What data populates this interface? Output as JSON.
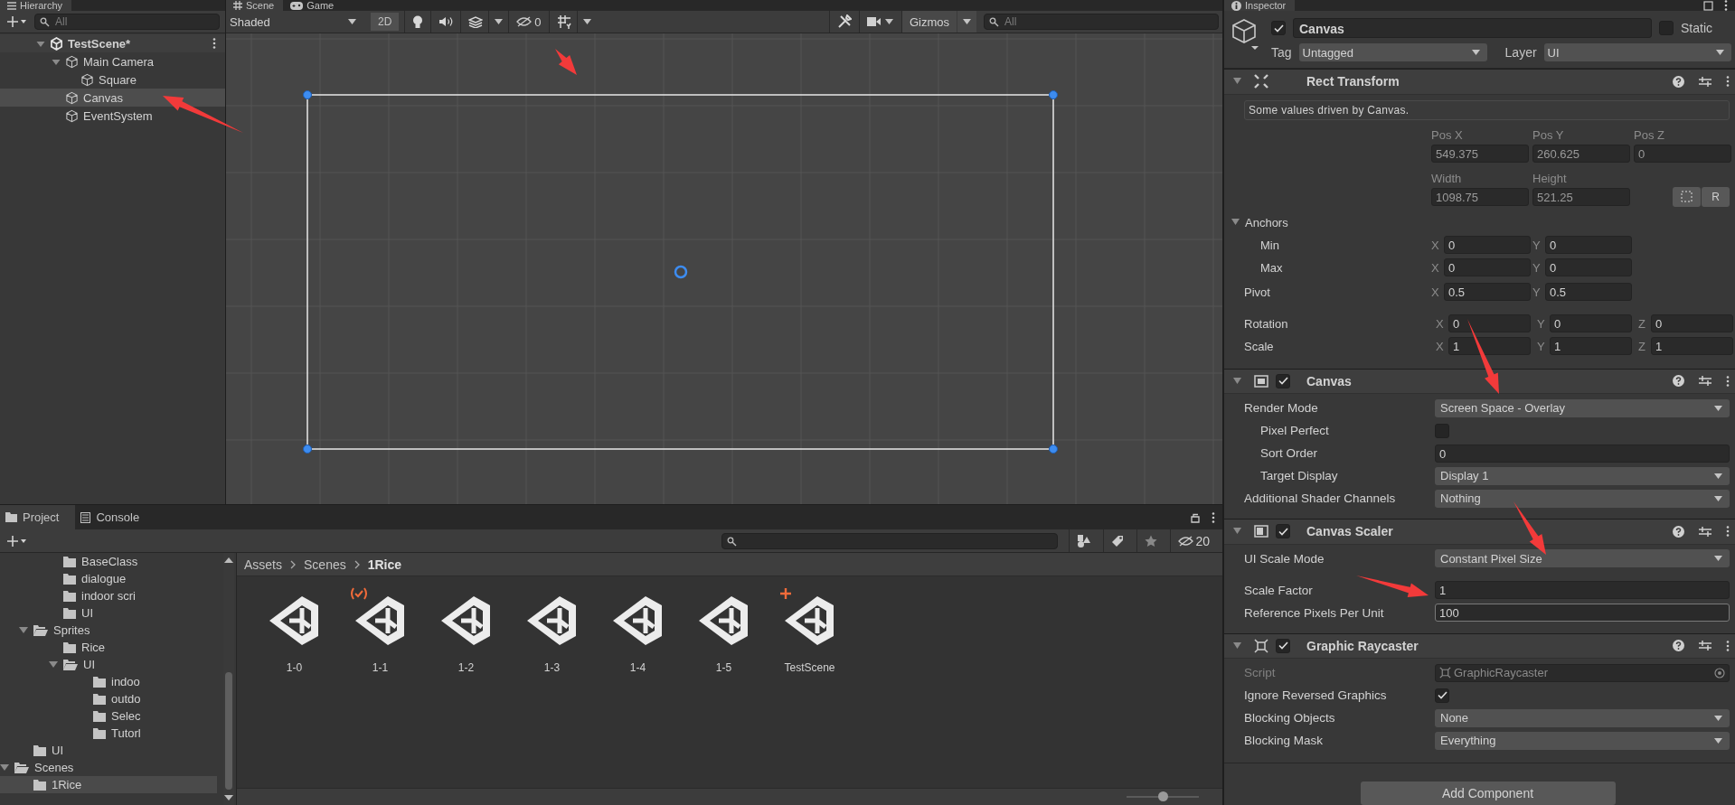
{
  "hierarchy": {
    "tab": {
      "label": "Hierarchy",
      "selected": true
    },
    "search": {
      "placeholder": "All"
    },
    "tree": [
      {
        "name": "TestScene*",
        "kind": "scene",
        "selected": false,
        "expanded": true,
        "children": [
          {
            "name": "Main Camera",
            "kind": "object",
            "selected": false,
            "expanded": true,
            "children": [
              {
                "name": "Square",
                "kind": "object",
                "selected": false
              }
            ]
          },
          {
            "name": "Canvas",
            "kind": "object",
            "selected": true
          },
          {
            "name": "EventSystem",
            "kind": "object",
            "selected": false
          }
        ]
      }
    ]
  },
  "scene_view": {
    "tabs": [
      {
        "label": "Scene",
        "kind": "scene",
        "selected": true
      },
      {
        "label": "Game",
        "kind": "game",
        "selected": false
      }
    ],
    "shading": "Shaded",
    "mode_2d": {
      "label": "2D",
      "on": false
    },
    "hidden_count": "0",
    "gizmos": "Gizmos",
    "search": {
      "placeholder": "All"
    }
  },
  "inspector": {
    "tab": {
      "label": "Inspector",
      "selected": true
    },
    "object": {
      "enabled": true,
      "name": "Canvas",
      "static": {
        "label": "Static",
        "checked": false
      },
      "tag": {
        "label": "Tag",
        "value": "Untagged"
      },
      "layer": {
        "label": "Layer",
        "value": "UI"
      }
    },
    "rect_transform": {
      "title": "Rect Transform",
      "expanded": true,
      "note": "Some values driven by Canvas.",
      "position": [
        {
          "label": "Pos X",
          "value": "549.375"
        },
        {
          "label": "Pos Y",
          "value": "260.625"
        },
        {
          "label": "Pos Z",
          "value": "0"
        }
      ],
      "size": [
        {
          "label": "Width",
          "value": "1098.75"
        },
        {
          "label": "Height",
          "value": "521.25"
        }
      ],
      "raw_button": "R",
      "anchors": {
        "label": "Anchors",
        "expanded": true,
        "rows": [
          {
            "label": "Min",
            "values": [
              {
                "axis": "X",
                "value": "0"
              },
              {
                "axis": "Y",
                "value": "0"
              }
            ]
          },
          {
            "label": "Max",
            "values": [
              {
                "axis": "X",
                "value": "0"
              },
              {
                "axis": "Y",
                "value": "0"
              }
            ]
          }
        ]
      },
      "pivot": {
        "label": "Pivot",
        "values": [
          {
            "axis": "X",
            "value": "0.5"
          },
          {
            "axis": "Y",
            "value": "0.5"
          }
        ]
      },
      "rotation": {
        "label": "Rotation",
        "values": [
          {
            "axis": "X",
            "value": "0"
          },
          {
            "axis": "Y",
            "value": "0"
          },
          {
            "axis": "Z",
            "value": "0"
          }
        ]
      },
      "scale": {
        "label": "Scale",
        "values": [
          {
            "axis": "X",
            "value": "1"
          },
          {
            "axis": "Y",
            "value": "1"
          },
          {
            "axis": "Z",
            "value": "1"
          }
        ]
      }
    },
    "components": [
      {
        "title": "Canvas",
        "kind": "canvas",
        "enabled": true,
        "expanded": true,
        "fields": [
          {
            "kind": "dropdown",
            "label": "Render Mode",
            "value": "Screen Space - Overlay",
            "children": [
              {
                "kind": "checkbox",
                "label": "Pixel Perfect",
                "checked": false
              },
              {
                "kind": "input",
                "label": "Sort Order",
                "value": "0"
              },
              {
                "kind": "dropdown",
                "label": "Target Display",
                "value": "Display 1"
              }
            ]
          },
          {
            "kind": "dropdown",
            "label": "Additional Shader Channels",
            "value": "Nothing"
          }
        ]
      },
      {
        "title": "Canvas Scaler",
        "kind": "canvas_scaler",
        "enabled": true,
        "expanded": true,
        "fields": [
          {
            "kind": "dropdown",
            "label": "UI Scale Mode",
            "value": "Constant Pixel Size"
          },
          {
            "kind": "input",
            "label": "Scale Factor",
            "value": "1"
          },
          {
            "kind": "input",
            "label": "Reference Pixels Per Unit",
            "value": "100",
            "focused": true
          }
        ]
      },
      {
        "title": "Graphic Raycaster",
        "kind": "graphic_raycaster",
        "enabled": true,
        "expanded": true,
        "fields": [
          {
            "kind": "object",
            "label": "Script",
            "value": "GraphicRaycaster",
            "disabled": true
          },
          {
            "kind": "checkbox",
            "label": "Ignore Reversed Graphics",
            "checked": true
          },
          {
            "kind": "dropdown",
            "label": "Blocking Objects",
            "value": "None"
          },
          {
            "kind": "dropdown",
            "label": "Blocking Mask",
            "value": "Everything"
          }
        ]
      }
    ],
    "add_button": "Add Component"
  },
  "project": {
    "tabs": [
      {
        "label": "Project",
        "kind": "project",
        "selected": true
      },
      {
        "label": "Console",
        "kind": "console",
        "selected": false
      }
    ],
    "hidden_count": "20",
    "tree": [
      {
        "children": [
          {
            "children": [
              {
                "name": "BaseClass",
                "selected": false
              },
              {
                "name": "dialogue",
                "selected": false
              },
              {
                "name": "indoor scri",
                "selected": false
              },
              {
                "name": "UI",
                "selected": false
              }
            ]
          },
          {
            "name": "Sprites",
            "selected": false,
            "expanded": true,
            "children": [
              {
                "name": "Rice",
                "selected": false
              },
              {
                "name": "UI",
                "selected": false,
                "expanded": true,
                "children": [
                  {
                    "name": "indoo",
                    "selected": false
                  },
                  {
                    "name": "outdo",
                    "selected": false
                  },
                  {
                    "name": "Selec",
                    "selected": false
                  },
                  {
                    "name": "Tutorl",
                    "selected": false
                  }
                ]
              }
            ]
          },
          {
            "name": "UI",
            "selected": false
          }
        ]
      },
      {
        "name": "Scenes",
        "selected": false,
        "expanded": true,
        "children": [
          {
            "name": "1Rice",
            "selected": true
          }
        ]
      }
    ],
    "breadcrumb": [
      "Assets",
      "Scenes",
      "1Rice"
    ],
    "assets": [
      {
        "name": "1-0",
        "kind": "plain"
      },
      {
        "name": "1-1",
        "kind": "synced"
      },
      {
        "name": "1-2",
        "kind": "plain"
      },
      {
        "name": "1-3",
        "kind": "plain"
      },
      {
        "name": "1-4",
        "kind": "plain"
      },
      {
        "name": "1-5",
        "kind": "plain"
      },
      {
        "name": "TestScene",
        "kind": "added"
      }
    ],
    "icon_size": {
      "level": 0.5
    }
  }
}
